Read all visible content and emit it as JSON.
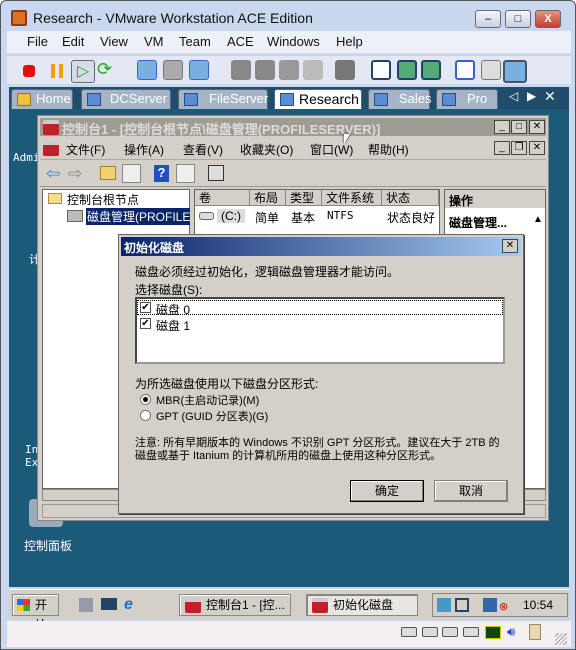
{
  "window": {
    "title": "Research - VMware Workstation ACE Edition",
    "minimize": "–",
    "maximize": "□",
    "close": "X"
  },
  "menu": [
    "File",
    "Edit",
    "View",
    "VM",
    "Team",
    "ACE",
    "Windows",
    "Help"
  ],
  "toolbar_icons": [
    "stop-icon",
    "pause-icon",
    "play-icon",
    "reset-icon",
    "snapshot-take-icon",
    "snapshot-revert-icon",
    "snapshot-manager-icon",
    "team-icon",
    "team-snapshot-icon",
    "appliance-icon",
    "usb-icon",
    "console-icon",
    "sidebar-icon",
    "fullscreen-icon",
    "quick-switch-icon",
    "settings-icon",
    "summary-icon",
    "console-view-icon"
  ],
  "tabs": [
    {
      "label": "Home"
    },
    {
      "label": "DCServer"
    },
    {
      "label": "FileServer"
    },
    {
      "label": "Research",
      "active": true
    },
    {
      "label": "Sales"
    },
    {
      "label": "Pro"
    }
  ],
  "tab_nav": {
    "prev": "◁",
    "next": "▶",
    "close": "✕"
  },
  "desktop": {
    "icons": [
      "Admi",
      "计",
      "In Ex",
      "控制面板"
    ]
  },
  "mmc": {
    "title": "控制台1 - [控制台根节点\\磁盘管理(PROFILESERVER)]",
    "menu": [
      "文件(F)",
      "操作(A)",
      "查看(V)",
      "收藏夹(O)",
      "窗口(W)",
      "帮助(H)"
    ],
    "tree": {
      "root": "控制台根节点",
      "child": "磁盘管理(PROFILES"
    },
    "columns": [
      "卷",
      "布局",
      "类型",
      "文件系统",
      "状态"
    ],
    "rows": [
      {
        "volume": "(C:)",
        "layout": "简单",
        "type": "基本",
        "fs": "NTFS",
        "status": "状态良好"
      }
    ],
    "actions": {
      "header": "操作",
      "item": "磁盘管理..."
    }
  },
  "dialog": {
    "title": "初始化磁盘",
    "intro": "磁盘必须经过初始化，逻辑磁盘管理器才能访问。",
    "select_label": "选择磁盘(S):",
    "disks": [
      {
        "label": "磁盘 0",
        "checked": true
      },
      {
        "label": "磁盘 1",
        "checked": true
      }
    ],
    "partition_label": "为所选磁盘使用以下磁盘分区形式:",
    "options": [
      {
        "label": "MBR(主启动记录)(M)",
        "selected": true
      },
      {
        "label": "GPT (GUID 分区表)(G)",
        "selected": false
      }
    ],
    "note": "注意: 所有早期版本的 Windows 不识别 GPT 分区形式。建议在大于 2TB 的磁盘或基于 Itanium 的计算机所用的磁盘上使用这种分区形式。",
    "ok": "确定",
    "cancel": "取消"
  },
  "taskbar": {
    "start": "开始",
    "tasks": [
      "控制台1 - [控...",
      "初始化磁盘"
    ],
    "clock": "10:54"
  }
}
